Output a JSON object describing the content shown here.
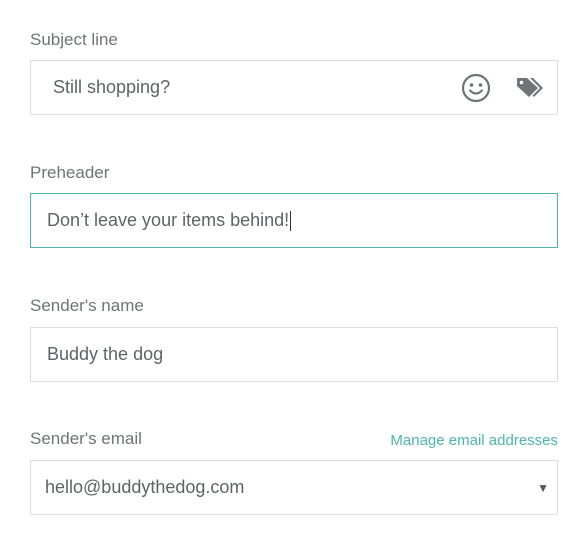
{
  "subject": {
    "label": "Subject line",
    "value": "Still shopping?",
    "emoji_icon": "smiley-icon",
    "tags_icon": "tags-icon"
  },
  "preheader": {
    "label": "Preheader",
    "value": "Don’t leave your items behind!"
  },
  "sender_name": {
    "label": "Sender's name",
    "value": "Buddy the dog"
  },
  "sender_email": {
    "label": "Sender's email",
    "manage_link": "Manage email addresses",
    "value": "hello@buddythedog.com"
  },
  "colors": {
    "accent": "#4db6ac",
    "border": "#dcdfe2",
    "text": "#5f6368"
  }
}
